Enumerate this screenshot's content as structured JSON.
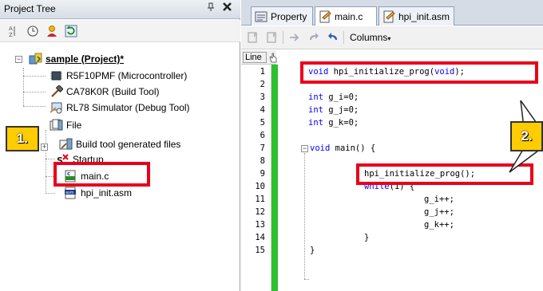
{
  "left_panel": {
    "title": "Project Tree",
    "pin_glyph": "p",
    "close_glyph": "✖",
    "tree": {
      "project": "sample (Project)*",
      "microcontroller": "R5F10PMF (Microcontroller)",
      "build_tool": "CA78K0R (Build Tool)",
      "debug_tool": "RL78 Simulator (Debug Tool)",
      "file_folder": "File",
      "generated_files": "Build tool generated files",
      "startup": "Startup",
      "main_c": "main.c",
      "hpi_init": "hpi_init.asm"
    }
  },
  "editor": {
    "tabs": [
      "Property",
      "main.c",
      "hpi_init.asm"
    ],
    "columns_label": "Columns",
    "line_header": "Line",
    "line_numbers": [
      "1",
      "2",
      "3",
      "4",
      "5",
      "6",
      "7",
      "8",
      "9",
      "10",
      "11",
      "12",
      "13",
      "14",
      "15"
    ],
    "code": {
      "l1_kw1": "void",
      "l1_mid": " hpi_initialize_prog(",
      "l1_kw2": "void",
      "l1_end": ");",
      "l3_kw": "int",
      "l3_rest": " g_i=0;",
      "l4_kw": "int",
      "l4_rest": " g_j=0;",
      "l5_kw": "int",
      "l5_rest": " g_k=0;",
      "l7_kw": "void",
      "l7_rest": " main() {",
      "l9": "hpi_initialize_prog();",
      "l10_kw": "while",
      "l10_rest": "(1) {",
      "l11": "g_i++;",
      "l12": "g_j++;",
      "l13": "g_k++;",
      "l14": "}",
      "l15": "}"
    }
  },
  "callouts": {
    "one": "1.",
    "two": "2."
  },
  "colors": {
    "highlight_red": "#e8001c",
    "callout_yellow": "#ffcc00",
    "keyword_blue": "#0000ff",
    "change_bar_green": "#2ec02e"
  }
}
